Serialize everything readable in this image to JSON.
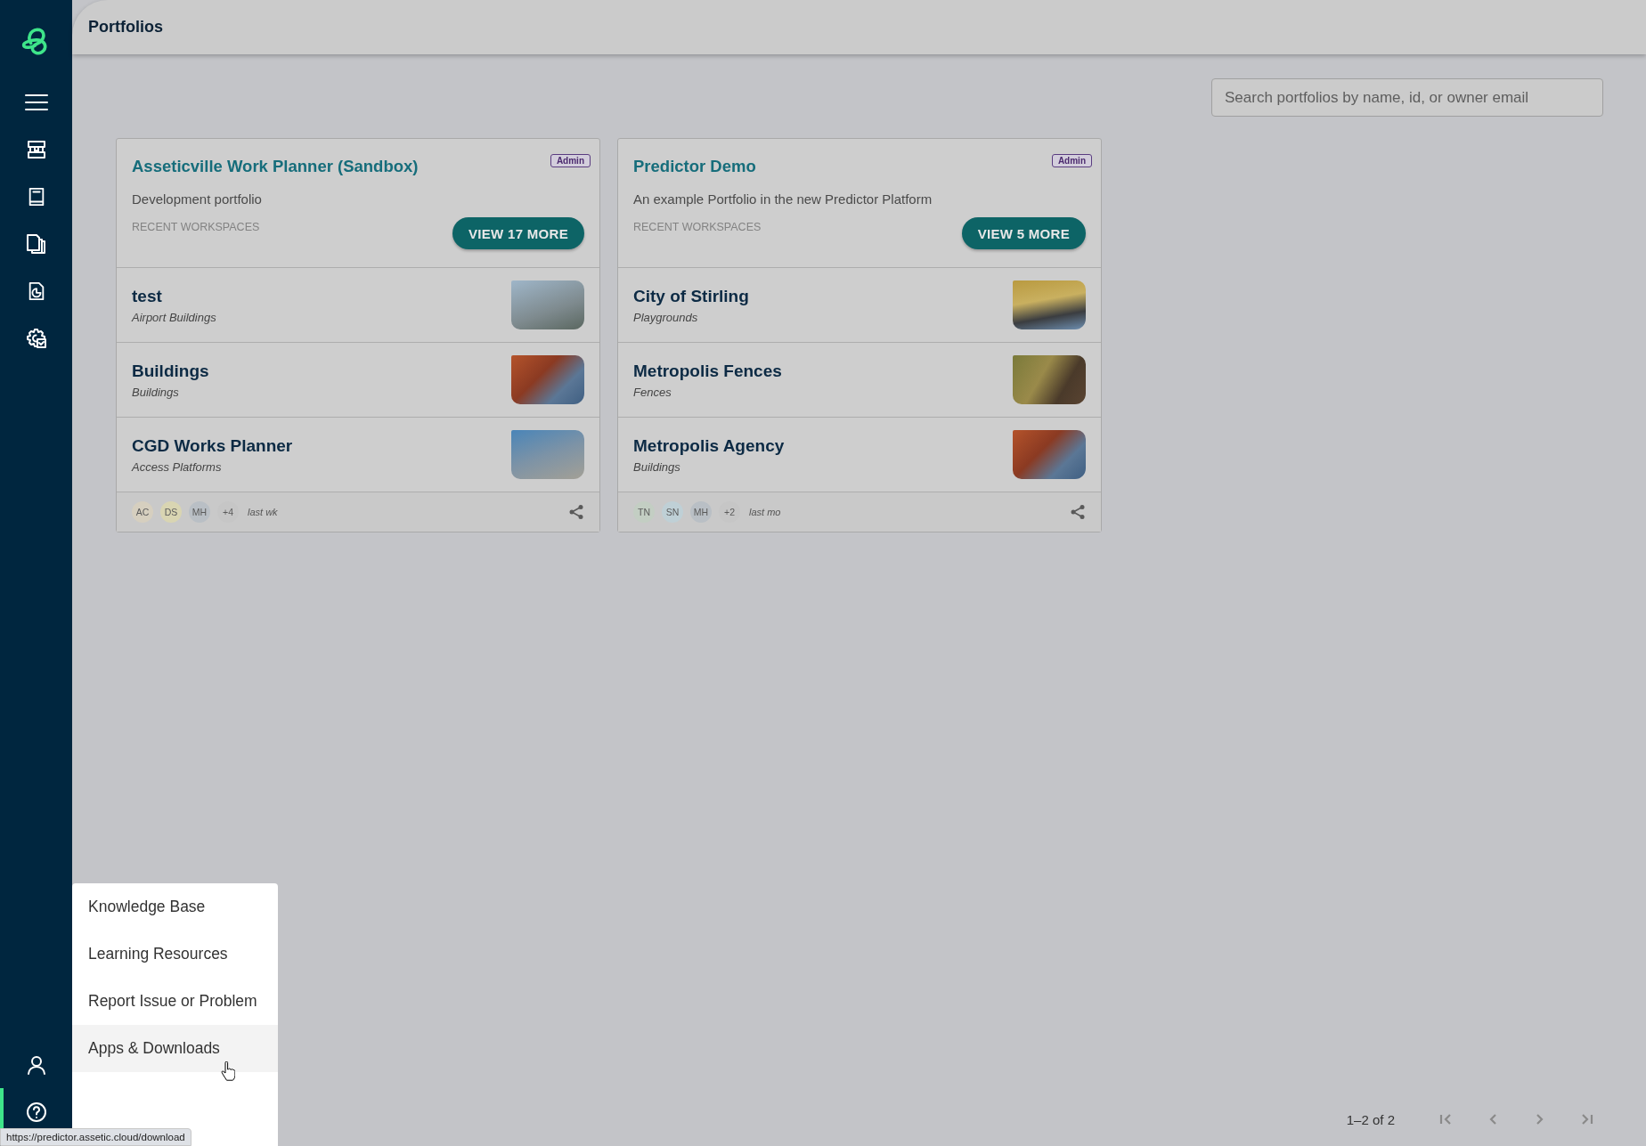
{
  "sidebar": {
    "top_items": [
      {
        "kind": "menu",
        "selected": false
      },
      {
        "kind": "workspaces",
        "selected": false
      },
      {
        "kind": "book",
        "selected": false
      },
      {
        "kind": "documents",
        "selected": false
      },
      {
        "kind": "report",
        "selected": false
      },
      {
        "kind": "settings",
        "selected": false
      }
    ],
    "bottom_items": [
      {
        "kind": "user",
        "selected": false
      },
      {
        "kind": "help",
        "selected": true
      }
    ]
  },
  "header": {
    "title": "Portfolios"
  },
  "search": {
    "placeholder": "Search portfolios by name, id, or owner email"
  },
  "portfolios": [
    {
      "title": "Asseticville Work Planner (Sandbox)",
      "badge": "Admin",
      "description": "Development portfolio",
      "section_label": "RECENT WORKSPACES",
      "button": "VIEW 17 MORE",
      "workspaces": [
        {
          "name": "test",
          "type": "Airport Buildings"
        },
        {
          "name": "Buildings",
          "type": "Buildings"
        },
        {
          "name": "CGD Works Planner",
          "type": "Access Platforms"
        }
      ],
      "members": [
        {
          "initials": "AC",
          "color": "#d6cfbf"
        },
        {
          "initials": "DS",
          "color": "#d9d5b2"
        },
        {
          "initials": "MH",
          "color": "#b9bfc5"
        },
        {
          "initials": "+4",
          "color": "#c6c6c6"
        }
      ],
      "updated": "last wk"
    },
    {
      "title": "Predictor Demo",
      "badge": "Admin",
      "description": "An example Portfolio in the new Predictor Platform",
      "section_label": "RECENT WORKSPACES",
      "button": "VIEW 5 MORE",
      "workspaces": [
        {
          "name": "City of Stirling",
          "type": "Playgrounds"
        },
        {
          "name": "Metropolis Fences",
          "type": "Fences"
        },
        {
          "name": "Metropolis Agency",
          "type": "Buildings"
        }
      ],
      "members": [
        {
          "initials": "TN",
          "color": "#c3cec3"
        },
        {
          "initials": "SN",
          "color": "#bfd0d6"
        },
        {
          "initials": "MH",
          "color": "#b9bfc5"
        },
        {
          "initials": "+2",
          "color": "#c6c6c6"
        }
      ],
      "updated": "last mo"
    }
  ],
  "pagination": {
    "range": "1–2 of 2",
    "buttons": [
      {
        "kind": "first",
        "disabled": true
      },
      {
        "kind": "prev",
        "disabled": true
      },
      {
        "kind": "next",
        "disabled": true
      },
      {
        "kind": "last",
        "disabled": true
      }
    ]
  },
  "help_menu": {
    "items": [
      {
        "label": "Knowledge Base",
        "hovered": false
      },
      {
        "label": "Learning Resources",
        "hovered": false
      },
      {
        "label": "Report Issue or Problem",
        "hovered": false
      },
      {
        "label": "Apps & Downloads",
        "hovered": true
      }
    ]
  },
  "status_url": "https://predictor.assetic.cloud/download"
}
